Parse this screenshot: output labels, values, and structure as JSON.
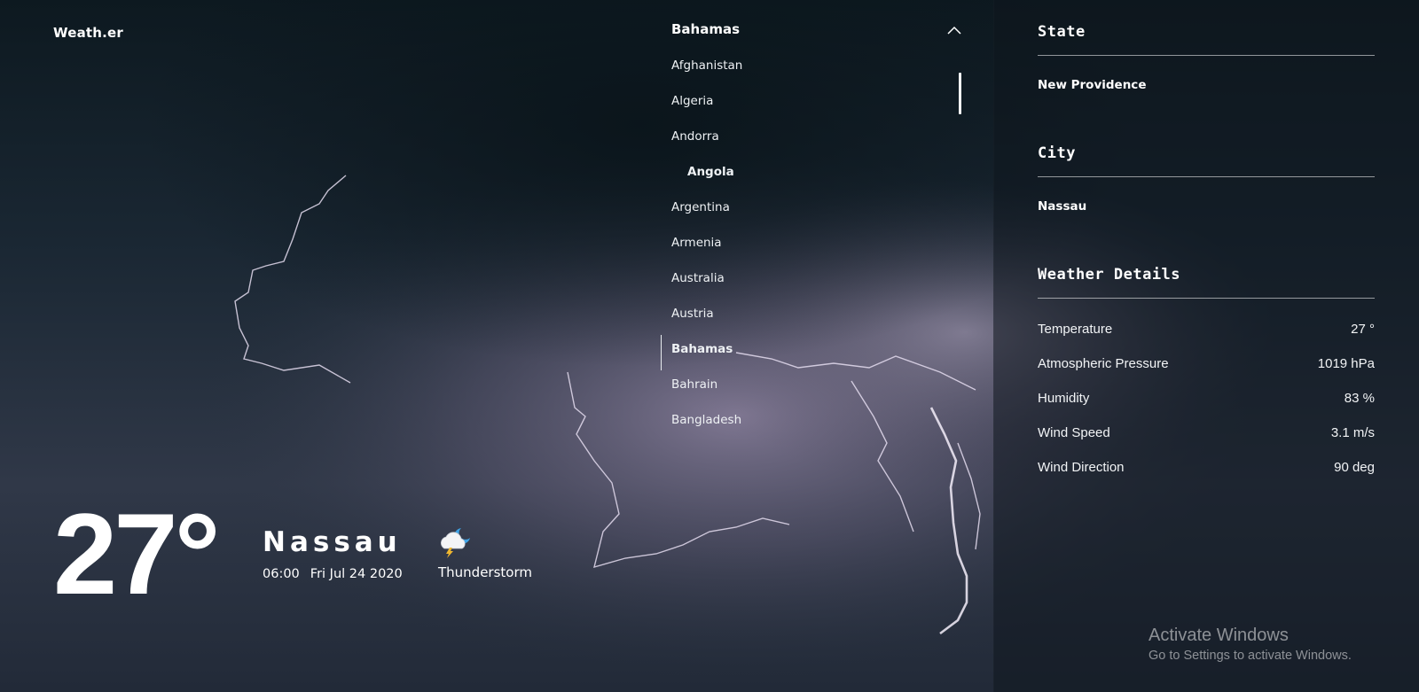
{
  "brand": "Weath.er",
  "country_dropdown": {
    "selected": "Bahamas",
    "items": [
      {
        "label": "Afghanistan",
        "state": ""
      },
      {
        "label": "Algeria",
        "state": ""
      },
      {
        "label": "Andorra",
        "state": ""
      },
      {
        "label": "Angola",
        "state": "hover"
      },
      {
        "label": "Argentina",
        "state": ""
      },
      {
        "label": "Armenia",
        "state": ""
      },
      {
        "label": "Australia",
        "state": ""
      },
      {
        "label": "Austria",
        "state": ""
      },
      {
        "label": "Bahamas",
        "state": "active"
      },
      {
        "label": "Bahrain",
        "state": ""
      },
      {
        "label": "Bangladesh",
        "state": ""
      }
    ]
  },
  "state_section": {
    "title": "State",
    "value": "New Providence"
  },
  "city_section": {
    "title": "City",
    "value": "Nassau"
  },
  "details_section": {
    "title": "Weather Details",
    "rows": [
      {
        "label": "Temperature",
        "value": "27 °"
      },
      {
        "label": "Atmospheric Pressure",
        "value": "1019 hPa"
      },
      {
        "label": "Humidity",
        "value": "83 %"
      },
      {
        "label": "Wind Speed",
        "value": "3.1 m/s"
      },
      {
        "label": "Wind Direction",
        "value": "90 deg"
      }
    ]
  },
  "current": {
    "temperature": "27°",
    "city": "Nassau",
    "time": "06:00",
    "date": "Fri Jul 24 2020",
    "condition": "Thunderstorm",
    "icon": "thunderstorm-night-icon"
  },
  "windows_notice": {
    "title": "Activate Windows",
    "subtitle": "Go to Settings to activate Windows."
  }
}
